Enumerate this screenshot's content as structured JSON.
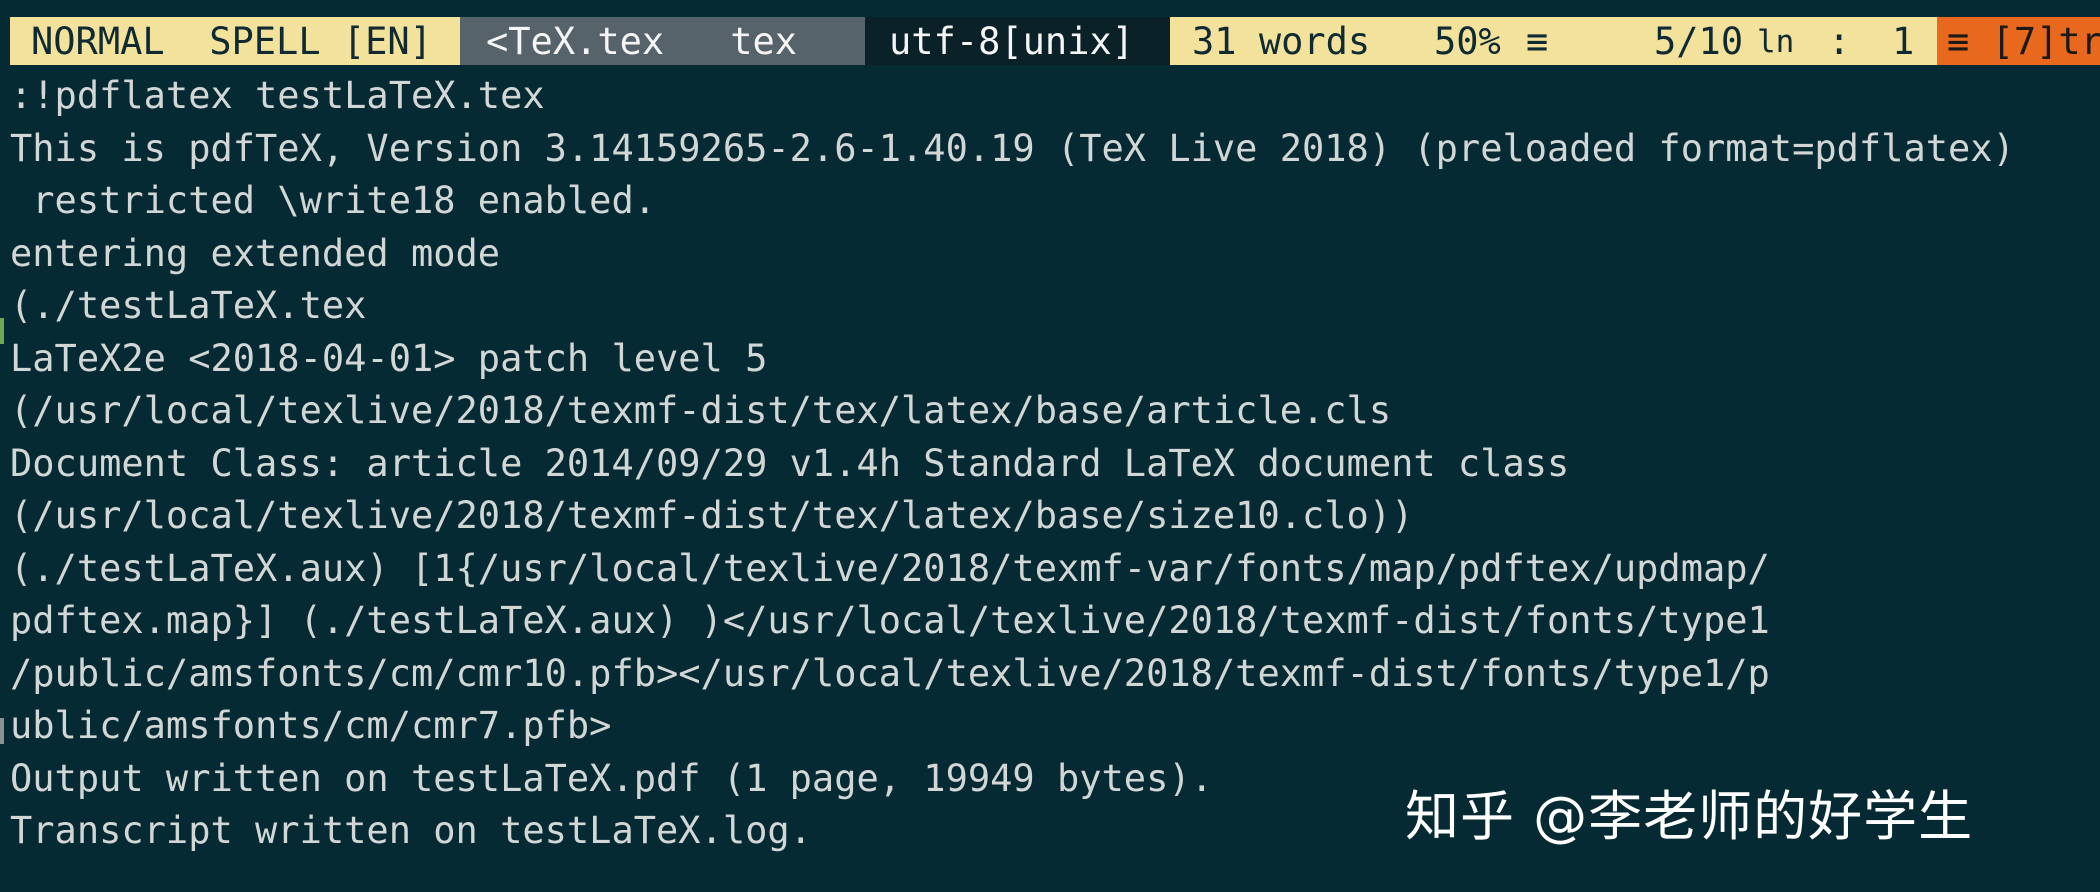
{
  "statusline": {
    "mode": "NORMAL",
    "spell": "SPELL [EN]",
    "file_name": "<TeX.tex",
    "file_type": "tex",
    "encoding": "utf-8[unix]",
    "word_count": "31 words",
    "percent": "50%",
    "percent_icon": "≡",
    "position": "5/10",
    "line_icon": "ln",
    "column_sep": ":",
    "column": "1",
    "warning_icon": "≡",
    "warning": "[7]tr"
  },
  "output": {
    "lines": [
      ":!pdflatex testLaTeX.tex",
      "This is pdfTeX, Version 3.14159265-2.6-1.40.19 (TeX Live 2018) (preloaded format=pdflatex)",
      " restricted \\write18 enabled.",
      "entering extended mode",
      "(./testLaTeX.tex",
      "LaTeX2e <2018-04-01> patch level 5",
      "(/usr/local/texlive/2018/texmf-dist/tex/latex/base/article.cls",
      "Document Class: article 2014/09/29 v1.4h Standard LaTeX document class",
      "(/usr/local/texlive/2018/texmf-dist/tex/latex/base/size10.clo))",
      "(./testLaTeX.aux) [1{/usr/local/texlive/2018/texmf-var/fonts/map/pdftex/updmap/",
      "pdftex.map}] (./testLaTeX.aux) )</usr/local/texlive/2018/texmf-dist/fonts/type1",
      "/public/amsfonts/cm/cmr10.pfb></usr/local/texlive/2018/texmf-dist/fonts/type1/p",
      "ublic/amsfonts/cm/cmr7.pfb>",
      "Output written on testLaTeX.pdf (1 page, 19949 bytes).",
      "Transcript written on testLaTeX.log."
    ]
  },
  "watermark": "知乎 @李老师的好学生",
  "colors": {
    "background": "#052a33",
    "statusline_yellow": "#f2e29b",
    "statusline_gray": "#56636a",
    "statusline_dark": "#0b2128",
    "statusline_orange": "#e8681e",
    "text": "#d2d7d5"
  }
}
